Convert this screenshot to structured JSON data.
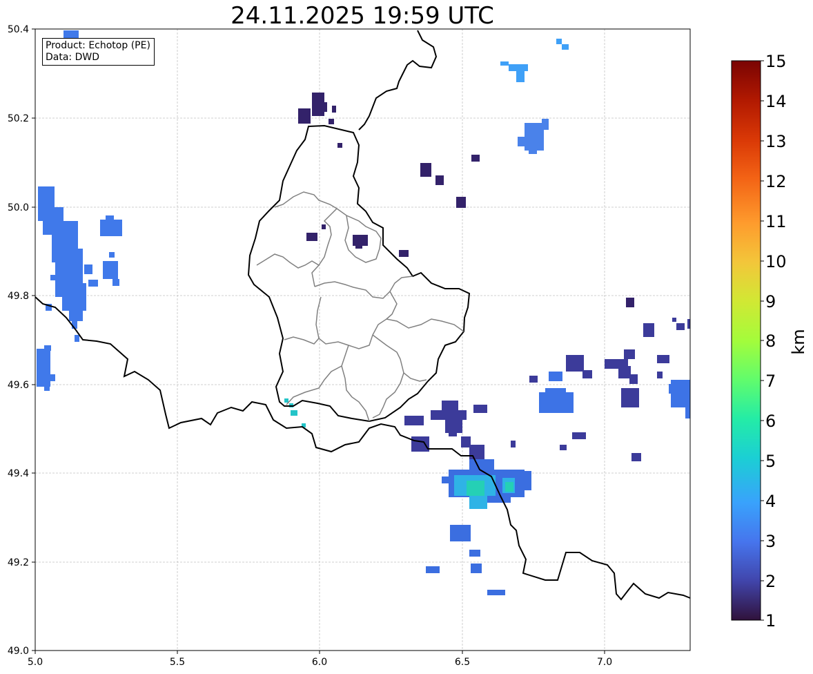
{
  "title": "24.11.2025 19:59 UTC",
  "info": {
    "product": "Product: Echotop (PE)",
    "data": "Data: DWD"
  },
  "axes": {
    "x_ticks": [
      "5.0",
      "5.5",
      "6.0",
      "6.5",
      "7.0"
    ],
    "y_ticks": [
      "50.4",
      "50.2",
      "50.0",
      "49.8",
      "49.6",
      "49.4",
      "49.2",
      "49.0"
    ]
  },
  "colorbar": {
    "label": "km",
    "ticks": [
      "15",
      "14",
      "13",
      "12",
      "11",
      "10",
      "9",
      "8",
      "7",
      "6",
      "5",
      "4",
      "3",
      "2",
      "1"
    ],
    "colors": {
      "low": "#30123b",
      "high": "#7a0403"
    }
  },
  "colors": {
    "border": "#000000",
    "region_border": "#808080",
    "grid": "#c0c0c0"
  }
}
